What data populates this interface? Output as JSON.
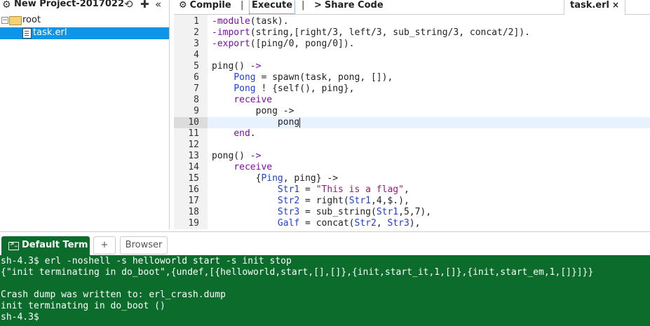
{
  "project": {
    "title": "New Project-2017022",
    "icons": [
      "gear-icon",
      "refresh-icon",
      "plus-icon",
      "collapse-icon"
    ],
    "tree": {
      "root_label": "root",
      "file_label": "task.erl"
    }
  },
  "toolbar": {
    "compile_label": "Compile",
    "execute_label": "Execute",
    "share_label": "Share Code",
    "separator": "|",
    "file_tab": "task.erl",
    "close_glyph": "×"
  },
  "editor": {
    "active_line": 10,
    "lines": [
      {
        "num": "1",
        "segments": [
          [
            "kw",
            "-module"
          ],
          [
            "",
            "(task)."
          ]
        ]
      },
      {
        "num": "2",
        "segments": [
          [
            "kw",
            "-import"
          ],
          [
            "",
            "(string,[right/3, left/3, sub_string/3, concat/2])."
          ]
        ]
      },
      {
        "num": "3",
        "segments": [
          [
            "kw",
            "-export"
          ],
          [
            "",
            "([ping/0, pong/0])."
          ]
        ]
      },
      {
        "num": "4",
        "segments": []
      },
      {
        "num": "5",
        "segments": [
          [
            "",
            "ping() "
          ],
          [
            "kw",
            "->"
          ]
        ]
      },
      {
        "num": "6",
        "segments": [
          [
            "",
            "    "
          ],
          [
            "var",
            "Pong"
          ],
          [
            "",
            " = spawn(task, pong, []),"
          ]
        ]
      },
      {
        "num": "7",
        "segments": [
          [
            "",
            "    "
          ],
          [
            "var",
            "Pong"
          ],
          [
            "",
            " ! {self(), ping},"
          ]
        ]
      },
      {
        "num": "8",
        "segments": [
          [
            "",
            "    "
          ],
          [
            "kw",
            "receive"
          ]
        ]
      },
      {
        "num": "9",
        "segments": [
          [
            "",
            "        pong ->"
          ]
        ]
      },
      {
        "num": "10",
        "segments": [
          [
            "",
            "            pong"
          ]
        ],
        "cursor": true
      },
      {
        "num": "11",
        "segments": [
          [
            "",
            "    "
          ],
          [
            "kw",
            "end"
          ],
          [
            "",
            "."
          ]
        ]
      },
      {
        "num": "12",
        "segments": []
      },
      {
        "num": "13",
        "segments": [
          [
            "",
            "pong() "
          ],
          [
            "kw",
            "->"
          ]
        ]
      },
      {
        "num": "14",
        "segments": [
          [
            "",
            "    "
          ],
          [
            "kw",
            "receive"
          ]
        ]
      },
      {
        "num": "15",
        "segments": [
          [
            "",
            "        {"
          ],
          [
            "var",
            "Ping"
          ],
          [
            "",
            ", ping} ->"
          ]
        ]
      },
      {
        "num": "16",
        "segments": [
          [
            "",
            "            "
          ],
          [
            "var",
            "Str1"
          ],
          [
            "",
            " = "
          ],
          [
            "str",
            "\"This is a flag\""
          ],
          [
            "",
            ","
          ]
        ]
      },
      {
        "num": "17",
        "segments": [
          [
            "",
            "            "
          ],
          [
            "var",
            "Str2"
          ],
          [
            "",
            " = right("
          ],
          [
            "var",
            "Str1"
          ],
          [
            "",
            ",4,$.),"
          ]
        ]
      },
      {
        "num": "18",
        "segments": [
          [
            "",
            "            "
          ],
          [
            "var",
            "Str3"
          ],
          [
            "",
            " = sub_string("
          ],
          [
            "var",
            "Str1"
          ],
          [
            "",
            ",5,7),"
          ]
        ]
      },
      {
        "num": "19",
        "segments": [
          [
            "",
            "            "
          ],
          [
            "var",
            "Galf"
          ],
          [
            "",
            " = concat("
          ],
          [
            "var",
            "Str2"
          ],
          [
            "",
            ", "
          ],
          [
            "var",
            "Str3"
          ],
          [
            "",
            "),"
          ]
        ]
      }
    ]
  },
  "terminal": {
    "tabs": {
      "default_label": "Default Term",
      "add_label": "+",
      "browser_label": "Browser"
    },
    "lines": [
      "sh-4.3$ erl -noshell -s helloworld start -s init stop",
      "{\"init terminating in do_boot\",{undef,[{helloworld,start,[],[]},{init,start_it,1,[]},{init,start_em,1,[]}]}}",
      "",
      "Crash dump was written to: erl_crash.dump",
      "init terminating in do_boot ()",
      "sh-4.3$"
    ]
  }
}
